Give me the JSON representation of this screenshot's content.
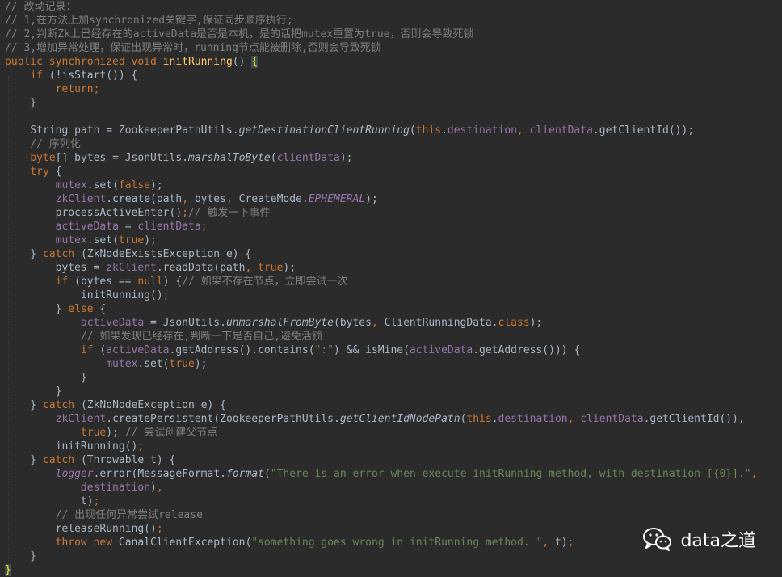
{
  "editor": {
    "background": "#2b2b2b",
    "colors": {
      "default": "#a9b7c6",
      "keyword": "#cc7832",
      "comment": "#808080",
      "string": "#6a8759",
      "field": "#9876aa",
      "method_decl": "#ffc66d",
      "brace_match": "#ffef28"
    },
    "lines": [
      [
        [
          "cmt",
          "// 改动记录："
        ]
      ],
      [
        [
          "cmt",
          "// 1,在方法上加synchronized关键字,保证同步顺序执行;"
        ]
      ],
      [
        [
          "cmt",
          "// 2,判断Zk上已经存在的activeData是否是本机，是的话把mutex重置为true，否则会导致死锁"
        ]
      ],
      [
        [
          "cmt",
          "// 3,增加异常处理，保证出现异常时，running节点能被删除,否则会导致死锁"
        ]
      ],
      [
        [
          "kw",
          "public synchronized void "
        ],
        [
          "fn",
          "initRunning"
        ],
        [
          "d",
          "() "
        ],
        [
          "brm",
          "{"
        ]
      ],
      [
        [
          "d",
          "    "
        ],
        [
          "kw",
          "if "
        ],
        [
          "d",
          "(!isStart()) {"
        ]
      ],
      [
        [
          "d",
          "        "
        ],
        [
          "kw",
          "return;"
        ]
      ],
      [
        [
          "d",
          "    }"
        ]
      ],
      [
        [
          "d",
          ""
        ]
      ],
      [
        [
          "d",
          "    String path = ZookeeperPathUtils."
        ],
        [
          "sfn",
          "getDestinationClientRunning"
        ],
        [
          "d",
          "("
        ],
        [
          "kw",
          "this"
        ],
        [
          "d",
          "."
        ],
        [
          "fld",
          "destination"
        ],
        [
          "kw",
          ", "
        ],
        [
          "fld",
          "clientData"
        ],
        [
          "d",
          ".getClientId());"
        ]
      ],
      [
        [
          "d",
          "    "
        ],
        [
          "cmt",
          "// 序列化"
        ]
      ],
      [
        [
          "d",
          "    "
        ],
        [
          "kw",
          "byte"
        ],
        [
          "d",
          "[] bytes = JsonUtils."
        ],
        [
          "sfn",
          "marshalToByte"
        ],
        [
          "d",
          "("
        ],
        [
          "fld",
          "clientData"
        ],
        [
          "d",
          ");"
        ]
      ],
      [
        [
          "d",
          "    "
        ],
        [
          "kw",
          "try "
        ],
        [
          "d",
          "{"
        ]
      ],
      [
        [
          "d",
          "        "
        ],
        [
          "fld",
          "mutex"
        ],
        [
          "d",
          ".set("
        ],
        [
          "kw",
          "false"
        ],
        [
          "d",
          ");"
        ]
      ],
      [
        [
          "d",
          "        "
        ],
        [
          "fld",
          "zkClient"
        ],
        [
          "d",
          ".create(path"
        ],
        [
          "kw",
          ", "
        ],
        [
          "d",
          "bytes"
        ],
        [
          "kw",
          ", "
        ],
        [
          "d",
          "CreateMode."
        ],
        [
          "fldi",
          "EPHEMERAL"
        ],
        [
          "d",
          ");"
        ]
      ],
      [
        [
          "d",
          "        processActiveEnter()"
        ],
        [
          "kw",
          ";"
        ],
        [
          "cmt",
          "// 触发一下事件"
        ]
      ],
      [
        [
          "d",
          "        "
        ],
        [
          "fld",
          "activeData "
        ],
        [
          "d",
          "= "
        ],
        [
          "fld",
          "clientData"
        ],
        [
          "kw",
          ";"
        ]
      ],
      [
        [
          "d",
          "        "
        ],
        [
          "fld",
          "mutex"
        ],
        [
          "d",
          ".set("
        ],
        [
          "kw",
          "true"
        ],
        [
          "d",
          ");"
        ]
      ],
      [
        [
          "d",
          "    } "
        ],
        [
          "kw",
          "catch "
        ],
        [
          "d",
          "(ZkNodeExistsException e) {"
        ]
      ],
      [
        [
          "d",
          "        bytes = "
        ],
        [
          "fld",
          "zkClient"
        ],
        [
          "d",
          ".readData(path"
        ],
        [
          "kw",
          ", true"
        ],
        [
          "d",
          ");"
        ]
      ],
      [
        [
          "d",
          "        "
        ],
        [
          "kw",
          "if "
        ],
        [
          "d",
          "(bytes == "
        ],
        [
          "kw",
          "null"
        ],
        [
          "d",
          ") {"
        ],
        [
          "cmt",
          "// 如果不存在节点，立即尝试一次"
        ]
      ],
      [
        [
          "d",
          "            initRunning()"
        ],
        [
          "kw",
          ";"
        ]
      ],
      [
        [
          "d",
          "        } "
        ],
        [
          "kw",
          "else "
        ],
        [
          "d",
          "{"
        ]
      ],
      [
        [
          "d",
          "            "
        ],
        [
          "fld",
          "activeData "
        ],
        [
          "d",
          "= JsonUtils."
        ],
        [
          "sfn",
          "unmarshalFromByte"
        ],
        [
          "d",
          "(bytes"
        ],
        [
          "kw",
          ", "
        ],
        [
          "d",
          "ClientRunningData."
        ],
        [
          "kw",
          "class"
        ],
        [
          "d",
          ");"
        ]
      ],
      [
        [
          "d",
          "            "
        ],
        [
          "cmt",
          "// 如果发现已经存在,判断一下是否自己,避免活锁"
        ]
      ],
      [
        [
          "d",
          "            "
        ],
        [
          "kw",
          "if "
        ],
        [
          "d",
          "("
        ],
        [
          "fld",
          "activeData"
        ],
        [
          "d",
          ".getAddress().contains("
        ],
        [
          "str",
          "\":\""
        ],
        [
          "d",
          ") && isMine("
        ],
        [
          "fld",
          "activeData"
        ],
        [
          "d",
          ".getAddress())) {"
        ]
      ],
      [
        [
          "d",
          "                "
        ],
        [
          "fld",
          "mutex"
        ],
        [
          "d",
          ".set("
        ],
        [
          "kw",
          "true"
        ],
        [
          "d",
          ");"
        ]
      ],
      [
        [
          "d",
          "            }"
        ]
      ],
      [
        [
          "d",
          "        }"
        ]
      ],
      [
        [
          "d",
          "    } "
        ],
        [
          "kw",
          "catch "
        ],
        [
          "d",
          "(ZkNoNodeException e) {"
        ]
      ],
      [
        [
          "d",
          "        "
        ],
        [
          "fld",
          "zkClient"
        ],
        [
          "d",
          ".createPersistent(ZookeeperPathUtils."
        ],
        [
          "sfn",
          "getClientIdNodePath"
        ],
        [
          "d",
          "("
        ],
        [
          "kw",
          "this"
        ],
        [
          "d",
          "."
        ],
        [
          "fld",
          "destination"
        ],
        [
          "kw",
          ", "
        ],
        [
          "fld",
          "clientData"
        ],
        [
          "d",
          ".getClientId()),"
        ]
      ],
      [
        [
          "d",
          "            "
        ],
        [
          "kw",
          "true"
        ],
        [
          "d",
          "); "
        ],
        [
          "cmt",
          "// 尝试创建父节点"
        ]
      ],
      [
        [
          "d",
          "        initRunning()"
        ],
        [
          "kw",
          ";"
        ]
      ],
      [
        [
          "d",
          "    } "
        ],
        [
          "kw",
          "catch "
        ],
        [
          "d",
          "(Throwable t) {"
        ]
      ],
      [
        [
          "d",
          "        "
        ],
        [
          "fldi",
          "logger"
        ],
        [
          "d",
          ".error(MessageFormat."
        ],
        [
          "sfn",
          "format"
        ],
        [
          "d",
          "("
        ],
        [
          "str",
          "\"There is an error when execute initRunning method, with destination [{0}].\""
        ],
        [
          "kw",
          ","
        ]
      ],
      [
        [
          "d",
          "            "
        ],
        [
          "fld",
          "destination"
        ],
        [
          "d",
          ")"
        ],
        [
          "kw",
          ","
        ]
      ],
      [
        [
          "d",
          "            t)"
        ],
        [
          "kw",
          ";"
        ]
      ],
      [
        [
          "d",
          "        "
        ],
        [
          "cmt",
          "// 出现任何异常尝试release"
        ]
      ],
      [
        [
          "d",
          "        releaseRunning()"
        ],
        [
          "kw",
          ";"
        ]
      ],
      [
        [
          "d",
          "        "
        ],
        [
          "kw",
          "throw new "
        ],
        [
          "d",
          "CanalClientException("
        ],
        [
          "str",
          "\"something goes wrong in initRunning method. \""
        ],
        [
          "kw",
          ", "
        ],
        [
          "d",
          "t)"
        ],
        [
          "kw",
          ";"
        ]
      ],
      [
        [
          "d",
          "    }"
        ]
      ],
      [
        [
          "brm",
          "}"
        ]
      ]
    ]
  },
  "watermark": {
    "icon": "wechat-icon",
    "text": "data之道",
    "color": "#ffffff"
  }
}
